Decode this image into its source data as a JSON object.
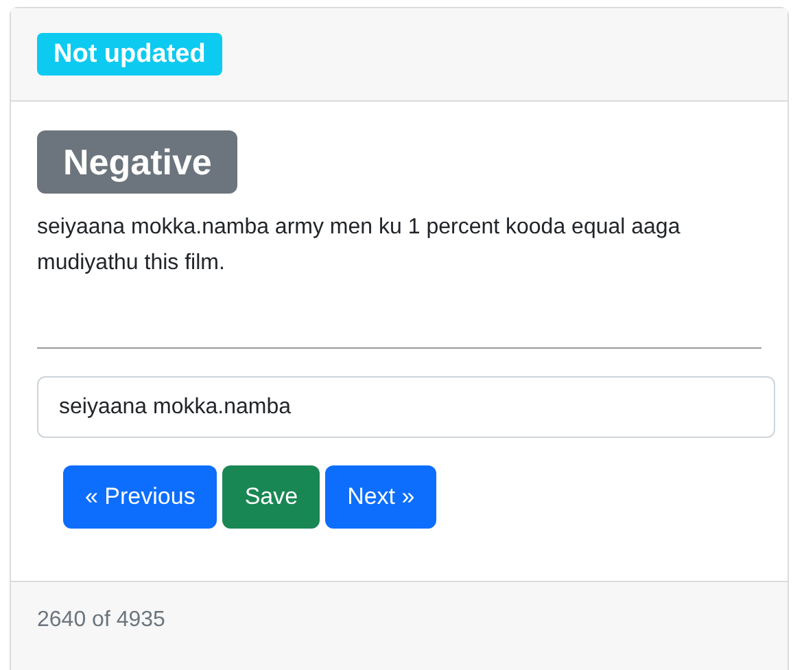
{
  "header": {
    "status_badge": "Not updated"
  },
  "sentiment_badge": "Negative",
  "review_text": "seiyaana mokka.namba army men ku 1 percent kooda equal aaga mudiyathu this film.",
  "input": {
    "value": "seiyaana mokka.namba"
  },
  "buttons": [
    {
      "label": "« Previous",
      "kind": "primary"
    },
    {
      "label": "Save",
      "kind": "success"
    },
    {
      "label": "Next »",
      "kind": "primary"
    }
  ],
  "footer": {
    "progress": "2640 of 4935"
  }
}
